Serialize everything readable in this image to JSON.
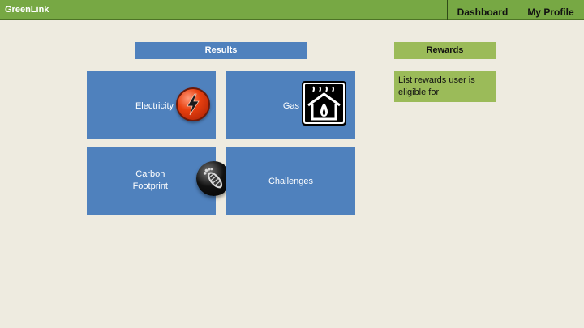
{
  "app": {
    "name": "GreenLink"
  },
  "nav": {
    "dashboard": "Dashboard",
    "profile": "My Profile"
  },
  "results": {
    "header": "Results",
    "tiles": [
      {
        "label": "Electricity",
        "icon": "electricity-icon"
      },
      {
        "label": "Gas",
        "icon": "gas-house-icon"
      },
      {
        "label_line1": "Carbon",
        "label_line2": "Footprint",
        "icon": "footprint-icon"
      },
      {
        "label": "Challenges"
      }
    ]
  },
  "rewards": {
    "header": "Rewards",
    "body": "List rewards user is eligible for"
  },
  "colors": {
    "topbar": "#77a844",
    "tile_blue": "#4f81bd",
    "rewards_green": "#9bbb59",
    "background": "#eeebe0"
  }
}
